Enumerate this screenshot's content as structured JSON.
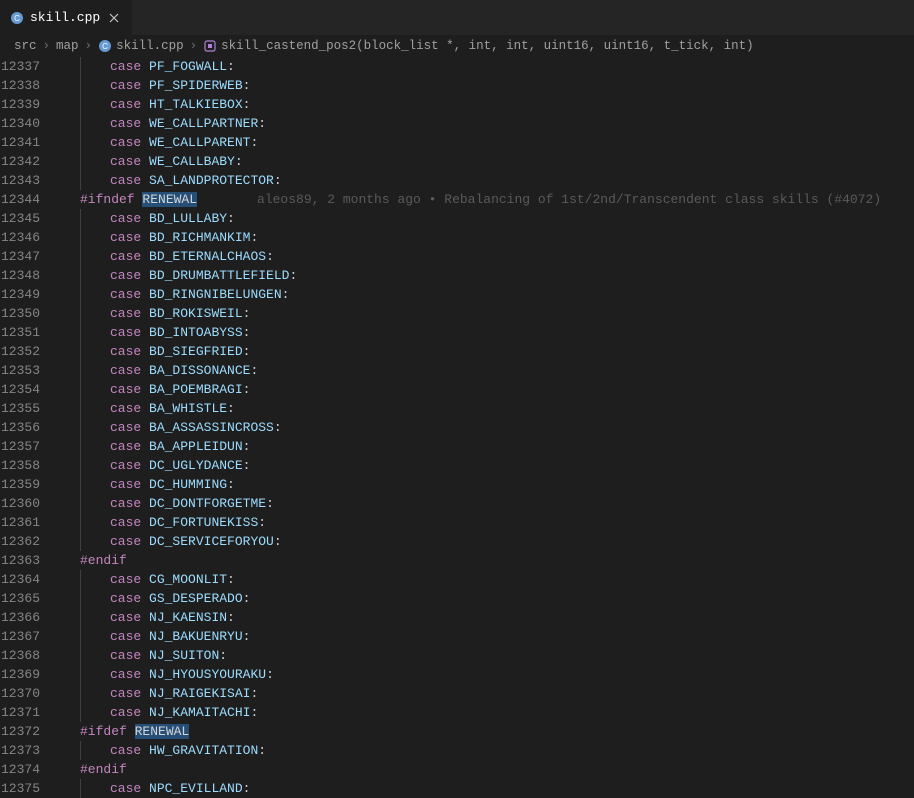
{
  "tab": {
    "icon": "cpp-icon",
    "filename": "skill.cpp"
  },
  "breadcrumbs": {
    "items": [
      {
        "label": "src"
      },
      {
        "label": "map"
      },
      {
        "label": "skill.cpp",
        "icon": "cpp-icon"
      },
      {
        "label": "skill_castend_pos2(block_list *, int, int, uint16, uint16, t_tick, int)",
        "icon": "symbol-function-icon"
      }
    ]
  },
  "blame": {
    "text": "aleos89, 2 months ago • Rebalancing of 1st/2nd/Transcendent class skills (#4072)"
  },
  "lines": [
    {
      "num": "12337",
      "indent": 3,
      "tokens": [
        {
          "t": "case",
          "c": "kw-case"
        },
        {
          "t": " "
        },
        {
          "t": "PF_FOGWALL",
          "c": "ident-blue"
        },
        {
          "t": ":",
          "c": "punct"
        }
      ]
    },
    {
      "num": "12338",
      "indent": 3,
      "tokens": [
        {
          "t": "case",
          "c": "kw-case"
        },
        {
          "t": " "
        },
        {
          "t": "PF_SPIDERWEB",
          "c": "ident-blue"
        },
        {
          "t": ":",
          "c": "punct"
        }
      ]
    },
    {
      "num": "12339",
      "indent": 3,
      "tokens": [
        {
          "t": "case",
          "c": "kw-case"
        },
        {
          "t": " "
        },
        {
          "t": "HT_TALKIEBOX",
          "c": "ident-blue"
        },
        {
          "t": ":",
          "c": "punct"
        }
      ]
    },
    {
      "num": "12340",
      "indent": 3,
      "tokens": [
        {
          "t": "case",
          "c": "kw-case"
        },
        {
          "t": " "
        },
        {
          "t": "WE_CALLPARTNER",
          "c": "ident-blue"
        },
        {
          "t": ":",
          "c": "punct"
        }
      ]
    },
    {
      "num": "12341",
      "indent": 3,
      "tokens": [
        {
          "t": "case",
          "c": "kw-case"
        },
        {
          "t": " "
        },
        {
          "t": "WE_CALLPARENT",
          "c": "ident-blue"
        },
        {
          "t": ":",
          "c": "punct"
        }
      ]
    },
    {
      "num": "12342",
      "indent": 3,
      "tokens": [
        {
          "t": "case",
          "c": "kw-case"
        },
        {
          "t": " "
        },
        {
          "t": "WE_CALLBABY",
          "c": "ident-blue"
        },
        {
          "t": ":",
          "c": "punct"
        }
      ]
    },
    {
      "num": "12343",
      "indent": 3,
      "tokens": [
        {
          "t": "case",
          "c": "kw-case"
        },
        {
          "t": " "
        },
        {
          "t": "SA_LANDPROTECTOR",
          "c": "ident-blue"
        },
        {
          "t": ":",
          "c": "punct"
        }
      ]
    },
    {
      "num": "12344",
      "indent": 0,
      "pp": true,
      "blame": true,
      "tokens": [
        {
          "t": "#ifndef",
          "c": "kw-pp"
        },
        {
          "t": " "
        },
        {
          "t": "RENEWAL",
          "c": "highlight"
        }
      ]
    },
    {
      "num": "12345",
      "indent": 3,
      "tokens": [
        {
          "t": "case",
          "c": "kw-case"
        },
        {
          "t": " "
        },
        {
          "t": "BD_LULLABY",
          "c": "ident-blue"
        },
        {
          "t": ":",
          "c": "punct"
        }
      ]
    },
    {
      "num": "12346",
      "indent": 3,
      "tokens": [
        {
          "t": "case",
          "c": "kw-case"
        },
        {
          "t": " "
        },
        {
          "t": "BD_RICHMANKIM",
          "c": "ident-blue"
        },
        {
          "t": ":",
          "c": "punct"
        }
      ]
    },
    {
      "num": "12347",
      "indent": 3,
      "tokens": [
        {
          "t": "case",
          "c": "kw-case"
        },
        {
          "t": " "
        },
        {
          "t": "BD_ETERNALCHAOS",
          "c": "ident-blue"
        },
        {
          "t": ":",
          "c": "punct"
        }
      ]
    },
    {
      "num": "12348",
      "indent": 3,
      "tokens": [
        {
          "t": "case",
          "c": "kw-case"
        },
        {
          "t": " "
        },
        {
          "t": "BD_DRUMBATTLEFIELD",
          "c": "ident-blue"
        },
        {
          "t": ":",
          "c": "punct"
        }
      ]
    },
    {
      "num": "12349",
      "indent": 3,
      "tokens": [
        {
          "t": "case",
          "c": "kw-case"
        },
        {
          "t": " "
        },
        {
          "t": "BD_RINGNIBELUNGEN",
          "c": "ident-blue"
        },
        {
          "t": ":",
          "c": "punct"
        }
      ]
    },
    {
      "num": "12350",
      "indent": 3,
      "tokens": [
        {
          "t": "case",
          "c": "kw-case"
        },
        {
          "t": " "
        },
        {
          "t": "BD_ROKISWEIL",
          "c": "ident-blue"
        },
        {
          "t": ":",
          "c": "punct"
        }
      ]
    },
    {
      "num": "12351",
      "indent": 3,
      "tokens": [
        {
          "t": "case",
          "c": "kw-case"
        },
        {
          "t": " "
        },
        {
          "t": "BD_INTOABYSS",
          "c": "ident-blue"
        },
        {
          "t": ":",
          "c": "punct"
        }
      ]
    },
    {
      "num": "12352",
      "indent": 3,
      "tokens": [
        {
          "t": "case",
          "c": "kw-case"
        },
        {
          "t": " "
        },
        {
          "t": "BD_SIEGFRIED",
          "c": "ident-blue"
        },
        {
          "t": ":",
          "c": "punct"
        }
      ]
    },
    {
      "num": "12353",
      "indent": 3,
      "tokens": [
        {
          "t": "case",
          "c": "kw-case"
        },
        {
          "t": " "
        },
        {
          "t": "BA_DISSONANCE",
          "c": "ident-blue"
        },
        {
          "t": ":",
          "c": "punct"
        }
      ]
    },
    {
      "num": "12354",
      "indent": 3,
      "tokens": [
        {
          "t": "case",
          "c": "kw-case"
        },
        {
          "t": " "
        },
        {
          "t": "BA_POEMBRAGI",
          "c": "ident-blue"
        },
        {
          "t": ":",
          "c": "punct"
        }
      ]
    },
    {
      "num": "12355",
      "indent": 3,
      "tokens": [
        {
          "t": "case",
          "c": "kw-case"
        },
        {
          "t": " "
        },
        {
          "t": "BA_WHISTLE",
          "c": "ident-blue"
        },
        {
          "t": ":",
          "c": "punct"
        }
      ]
    },
    {
      "num": "12356",
      "indent": 3,
      "tokens": [
        {
          "t": "case",
          "c": "kw-case"
        },
        {
          "t": " "
        },
        {
          "t": "BA_ASSASSINCROSS",
          "c": "ident-blue"
        },
        {
          "t": ":",
          "c": "punct"
        }
      ]
    },
    {
      "num": "12357",
      "indent": 3,
      "tokens": [
        {
          "t": "case",
          "c": "kw-case"
        },
        {
          "t": " "
        },
        {
          "t": "BA_APPLEIDUN",
          "c": "ident-blue"
        },
        {
          "t": ":",
          "c": "punct"
        }
      ]
    },
    {
      "num": "12358",
      "indent": 3,
      "tokens": [
        {
          "t": "case",
          "c": "kw-case"
        },
        {
          "t": " "
        },
        {
          "t": "DC_UGLYDANCE",
          "c": "ident-blue"
        },
        {
          "t": ":",
          "c": "punct"
        }
      ]
    },
    {
      "num": "12359",
      "indent": 3,
      "tokens": [
        {
          "t": "case",
          "c": "kw-case"
        },
        {
          "t": " "
        },
        {
          "t": "DC_HUMMING",
          "c": "ident-blue"
        },
        {
          "t": ":",
          "c": "punct"
        }
      ]
    },
    {
      "num": "12360",
      "indent": 3,
      "tokens": [
        {
          "t": "case",
          "c": "kw-case"
        },
        {
          "t": " "
        },
        {
          "t": "DC_DONTFORGETME",
          "c": "ident-blue"
        },
        {
          "t": ":",
          "c": "punct"
        }
      ]
    },
    {
      "num": "12361",
      "indent": 3,
      "tokens": [
        {
          "t": "case",
          "c": "kw-case"
        },
        {
          "t": " "
        },
        {
          "t": "DC_FORTUNEKISS",
          "c": "ident-blue"
        },
        {
          "t": ":",
          "c": "punct"
        }
      ]
    },
    {
      "num": "12362",
      "indent": 3,
      "tokens": [
        {
          "t": "case",
          "c": "kw-case"
        },
        {
          "t": " "
        },
        {
          "t": "DC_SERVICEFORYOU",
          "c": "ident-blue"
        },
        {
          "t": ":",
          "c": "punct"
        }
      ]
    },
    {
      "num": "12363",
      "indent": 0,
      "pp": true,
      "tokens": [
        {
          "t": "#endif",
          "c": "kw-pp"
        }
      ]
    },
    {
      "num": "12364",
      "indent": 3,
      "tokens": [
        {
          "t": "case",
          "c": "kw-case"
        },
        {
          "t": " "
        },
        {
          "t": "CG_MOONLIT",
          "c": "ident-blue"
        },
        {
          "t": ":",
          "c": "punct"
        }
      ]
    },
    {
      "num": "12365",
      "indent": 3,
      "tokens": [
        {
          "t": "case",
          "c": "kw-case"
        },
        {
          "t": " "
        },
        {
          "t": "GS_DESPERADO",
          "c": "ident-blue"
        },
        {
          "t": ":",
          "c": "punct"
        }
      ]
    },
    {
      "num": "12366",
      "indent": 3,
      "tokens": [
        {
          "t": "case",
          "c": "kw-case"
        },
        {
          "t": " "
        },
        {
          "t": "NJ_KAENSIN",
          "c": "ident-blue"
        },
        {
          "t": ":",
          "c": "punct"
        }
      ]
    },
    {
      "num": "12367",
      "indent": 3,
      "tokens": [
        {
          "t": "case",
          "c": "kw-case"
        },
        {
          "t": " "
        },
        {
          "t": "NJ_BAKUENRYU",
          "c": "ident-blue"
        },
        {
          "t": ":",
          "c": "punct"
        }
      ]
    },
    {
      "num": "12368",
      "indent": 3,
      "tokens": [
        {
          "t": "case",
          "c": "kw-case"
        },
        {
          "t": " "
        },
        {
          "t": "NJ_SUITON",
          "c": "ident-blue"
        },
        {
          "t": ":",
          "c": "punct"
        }
      ]
    },
    {
      "num": "12369",
      "indent": 3,
      "tokens": [
        {
          "t": "case",
          "c": "kw-case"
        },
        {
          "t": " "
        },
        {
          "t": "NJ_HYOUSYOURAKU",
          "c": "ident-blue"
        },
        {
          "t": ":",
          "c": "punct"
        }
      ]
    },
    {
      "num": "12370",
      "indent": 3,
      "tokens": [
        {
          "t": "case",
          "c": "kw-case"
        },
        {
          "t": " "
        },
        {
          "t": "NJ_RAIGEKISAI",
          "c": "ident-blue"
        },
        {
          "t": ":",
          "c": "punct"
        }
      ]
    },
    {
      "num": "12371",
      "indent": 3,
      "tokens": [
        {
          "t": "case",
          "c": "kw-case"
        },
        {
          "t": " "
        },
        {
          "t": "NJ_KAMAITACHI",
          "c": "ident-blue"
        },
        {
          "t": ":",
          "c": "punct"
        }
      ]
    },
    {
      "num": "12372",
      "indent": 0,
      "pp": true,
      "tokens": [
        {
          "t": "#ifdef",
          "c": "kw-pp"
        },
        {
          "t": " "
        },
        {
          "t": "RENEWAL",
          "c": "highlight"
        }
      ]
    },
    {
      "num": "12373",
      "indent": 3,
      "tokens": [
        {
          "t": "case",
          "c": "kw-case"
        },
        {
          "t": " "
        },
        {
          "t": "HW_GRAVITATION",
          "c": "ident-blue"
        },
        {
          "t": ":",
          "c": "punct"
        }
      ]
    },
    {
      "num": "12374",
      "indent": 0,
      "pp": true,
      "tokens": [
        {
          "t": "#endif",
          "c": "kw-pp"
        }
      ]
    },
    {
      "num": "12375",
      "indent": 3,
      "tokens": [
        {
          "t": "case",
          "c": "kw-case"
        },
        {
          "t": " "
        },
        {
          "t": "NPC_EVILLAND",
          "c": "ident-blue"
        },
        {
          "t": ":",
          "c": "punct"
        }
      ]
    }
  ]
}
